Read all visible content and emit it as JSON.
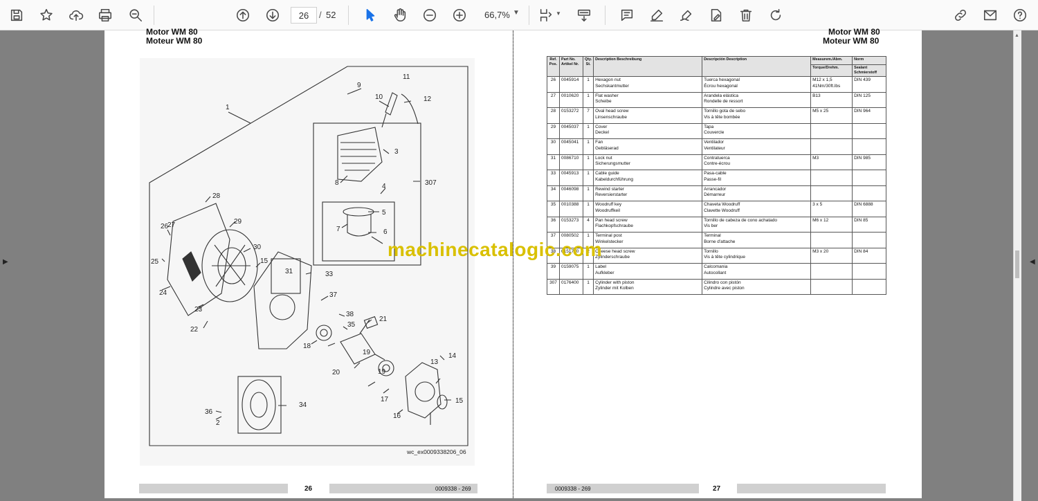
{
  "toolbar": {
    "current_page": "26",
    "page_separator": "/",
    "total_pages": "52",
    "zoom": "66,7%"
  },
  "left_page": {
    "title_line1": "Motor WM 80",
    "title_line2": "Moteur WM 80",
    "page_number": "26",
    "doc_code": "0009338 - 269",
    "figure_caption": "wc_ex0009338206_06",
    "callouts": [
      "1",
      "2",
      "3",
      "4",
      "5",
      "6",
      "7",
      "8",
      "9",
      "10",
      "11",
      "12",
      "13",
      "14",
      "15",
      "15",
      "16",
      "17",
      "18",
      "19",
      "19",
      "20",
      "21",
      "22",
      "23",
      "24",
      "25",
      "26",
      "27",
      "28",
      "29",
      "30",
      "31",
      "33",
      "34",
      "35",
      "36",
      "37",
      "38",
      "307"
    ]
  },
  "right_page": {
    "title_line1": "Motor WM 80",
    "title_line2": "Moteur WM 80",
    "page_number": "27",
    "doc_code": "0009338 - 269",
    "watermark": "machinecatalogic.com",
    "table": {
      "headers": {
        "ref": "Ref. Pos.",
        "part": "Part No. Artikel Nr.",
        "qty": "Qty. St.",
        "desc_en": "Description Beschreibung",
        "desc_es": "Descripción Description",
        "meas": "Measurem./Abm.",
        "meas_sub": "Torque/Drehm.",
        "norm": "Norm",
        "norm_sub": "Sealant Schmierstoff"
      },
      "rows": [
        {
          "ref": "26",
          "part": "0045914",
          "qty": "1",
          "en": "Hexagon nut",
          "de": "Sechskantmutter",
          "es": "Tuerca hexagonal",
          "fr": "Écrou hexagonal",
          "meas": "M12 x 1,5",
          "torque": "41Nm/30ft.lbs",
          "norm": "DIN 439"
        },
        {
          "ref": "27",
          "part": "0010620",
          "qty": "1",
          "en": "Flat washer",
          "de": "Scheibe",
          "es": "Arandela elástica",
          "fr": "Rondelle de ressort",
          "meas": "B13",
          "torque": "",
          "norm": "DIN 125"
        },
        {
          "ref": "28",
          "part": "0153272",
          "qty": "7",
          "en": "Oval head screw",
          "de": "Linsenschraube",
          "es": "Tornillo gota de sebo",
          "fr": "Vis à tête bombée",
          "meas": "M5 x 25",
          "torque": "",
          "norm": "DIN 964"
        },
        {
          "ref": "29",
          "part": "0045037",
          "qty": "1",
          "en": "Cover",
          "de": "Deckel",
          "es": "Tapa",
          "fr": "Couvercle",
          "meas": "",
          "torque": "",
          "norm": ""
        },
        {
          "ref": "30",
          "part": "0045041",
          "qty": "1",
          "en": "Fan",
          "de": "Gebläserad",
          "es": "Ventilador",
          "fr": "Ventilateur",
          "meas": "",
          "torque": "",
          "norm": ""
        },
        {
          "ref": "31",
          "part": "0086710",
          "qty": "1",
          "en": "Lock nut",
          "de": "Sicherungsmutter",
          "es": "Contratuerca",
          "fr": "Contre-écrou",
          "meas": "M3",
          "torque": "",
          "norm": "DIN 985"
        },
        {
          "ref": "33",
          "part": "0045913",
          "qty": "1",
          "en": "Cable guide",
          "de": "Kabeldurchführung",
          "es": "Pasa-cable",
          "fr": "Passe-fil",
          "meas": "",
          "torque": "",
          "norm": ""
        },
        {
          "ref": "34",
          "part": "0046098",
          "qty": "1",
          "en": "Rewind starter",
          "de": "Reversierstarter",
          "es": "Arrancador",
          "fr": "Démarreur",
          "meas": "",
          "torque": "",
          "norm": ""
        },
        {
          "ref": "35",
          "part": "0010388",
          "qty": "1",
          "en": "Woodruff key",
          "de": "Woodruffkeil",
          "es": "Chaveta Woodruff",
          "fr": "Clavette Woodruff",
          "meas": "3 x 5",
          "torque": "",
          "norm": "DIN 6888"
        },
        {
          "ref": "36",
          "part": "0153273",
          "qty": "4",
          "en": "Pan head screw",
          "de": "Flachkopfschraube",
          "es": "Tornillo de cabeza de cono achatado",
          "fr": "Vis ber",
          "meas": "M6 x 12",
          "torque": "",
          "norm": "DIN 85"
        },
        {
          "ref": "37",
          "part": "0080502",
          "qty": "1",
          "en": "Terminal post",
          "de": "Winkelstecker",
          "es": "Terminal",
          "fr": "Borne d'attache",
          "meas": "",
          "torque": "",
          "norm": ""
        },
        {
          "ref": "38",
          "part": "0151780",
          "qty": "2",
          "en": "Cheese head screw",
          "de": "Zylinderschraube",
          "es": "Tornillo",
          "fr": "Vis à tête cylindrique",
          "meas": "M3 x 20",
          "torque": "",
          "norm": "DIN 84"
        },
        {
          "ref": "39",
          "part": "0159075",
          "qty": "1",
          "en": "Label",
          "de": "Aufkleber",
          "es": "Calcomania",
          "fr": "Autocollant",
          "meas": "",
          "torque": "",
          "norm": ""
        },
        {
          "ref": "307",
          "part": "0176400",
          "qty": "1",
          "en": "Cylinder with piston",
          "de": "Zylinder mit Kolben",
          "es": "Cilindro con pistón",
          "fr": "Cylindre avec piston",
          "meas": "",
          "torque": "",
          "norm": ""
        }
      ]
    }
  },
  "colors": {
    "toolbar_bg": "#fafafa",
    "workspace_bg": "#808080",
    "accent_blue": "#1a73e8",
    "watermark": "#d9c000"
  },
  "icons": [
    "save-icon",
    "bookmark-star-icon",
    "upload-cloud-icon",
    "print-icon",
    "zoom-search-icon",
    "page-up-icon",
    "page-down-icon",
    "select-cursor-icon",
    "hand-pan-icon",
    "zoom-out-icon",
    "zoom-in-icon",
    "fit-page-icon",
    "scroll-mode-icon",
    "comment-icon",
    "highlight-pen-icon",
    "draw-sign-icon",
    "edit-pdf-icon",
    "delete-icon",
    "rotate-icon",
    "link-sign-icon",
    "email-icon",
    "help-user-icon"
  ]
}
